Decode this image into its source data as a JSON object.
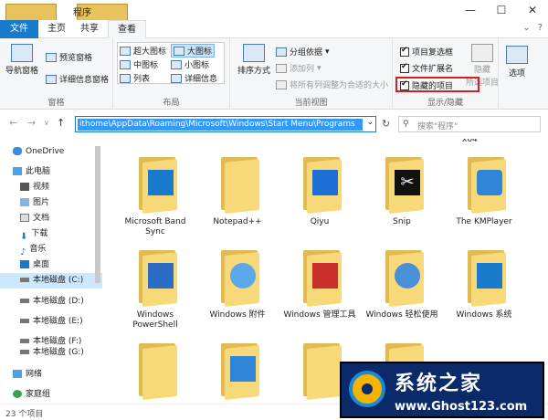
{
  "window": {
    "title": "程序",
    "controls": {
      "minimize": "—",
      "maximize": "☐",
      "close": "✕"
    }
  },
  "menu": {
    "tabs": [
      "文件",
      "主页",
      "共享",
      "查看"
    ],
    "help": "?"
  },
  "ribbon": {
    "pane_group": {
      "label": "窗格",
      "nav_pane": "导航窗格",
      "preview_pane": "预览窗格",
      "details_pane": "详细信息窗格"
    },
    "layout_group": {
      "label": "布局",
      "options": [
        "超大图标",
        "大图标",
        "中图标",
        "小图标",
        "列表",
        "详细信息"
      ]
    },
    "view_group": {
      "label": "当前视图",
      "sort": "排序方式",
      "group_by": "分组依据",
      "add_column": "添加列",
      "fit_columns": "将所有列调整为合适的大小"
    },
    "show_hide_group": {
      "label": "显示/隐藏",
      "item_checkboxes": "项目复选框",
      "file_extensions": "文件扩展名",
      "hidden_items": "隐藏的项目",
      "hide_selected_line1": "隐藏",
      "hide_selected_line2": "所选项目"
    },
    "options": "选项"
  },
  "address": {
    "path": "ithome\\AppData\\Roaming\\Microsoft\\Windows\\Start Menu\\Programs",
    "search_placeholder": "搜索\"程序\""
  },
  "nav_pane": {
    "items": [
      {
        "label": "OneDrive"
      },
      {
        "label": "此电脑"
      },
      {
        "label": "视频"
      },
      {
        "label": "图片"
      },
      {
        "label": "文档"
      },
      {
        "label": "下载"
      },
      {
        "label": "音乐"
      },
      {
        "label": "桌面"
      },
      {
        "label": "本地磁盘 (C:)"
      },
      {
        "label": "本地磁盘 (D:)"
      },
      {
        "label": "本地磁盘 (E:)"
      },
      {
        "label": "本地磁盘 (F:)"
      },
      {
        "label": "本地磁盘 (G:)"
      },
      {
        "label": "网络"
      },
      {
        "label": "家庭组"
      }
    ]
  },
  "files": {
    "header_label": "x64",
    "row1": [
      "Microsoft Band Sync",
      "Notepad++",
      "Qiyu",
      "Snip",
      "The KMPlayer"
    ],
    "row2": [
      "Windows PowerShell",
      "Windows 附件",
      "Windows 管理工具",
      "Windows 轻松使用",
      "Windows 系统"
    ]
  },
  "status": {
    "count": "23 个项目"
  },
  "watermark": {
    "name": "系统之家",
    "url": "www.Ghost123.com"
  },
  "colors": {
    "accent": "#1979ca",
    "highlight_box": "#d32020",
    "folder": "#f7d97a"
  }
}
